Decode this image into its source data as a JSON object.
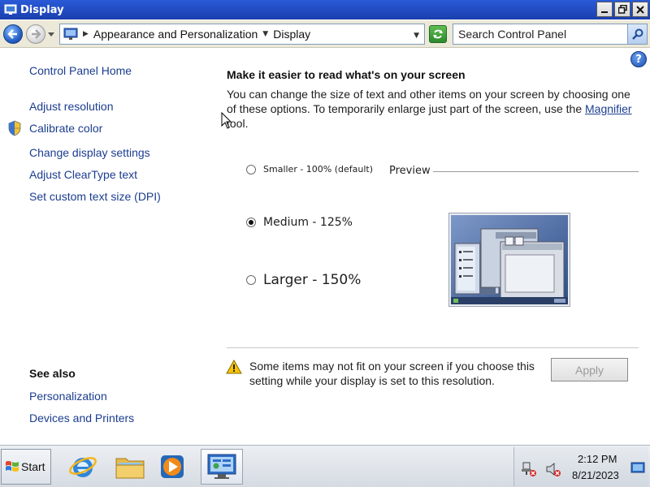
{
  "window": {
    "title": "Display"
  },
  "navbar": {
    "breadcrumb": [
      "Appearance and Personalization",
      "Display"
    ],
    "search_placeholder": "Search Control Panel"
  },
  "left_pane": {
    "links": [
      "Control Panel Home",
      "Adjust resolution",
      "Calibrate color",
      "Change display settings",
      "Adjust ClearType text",
      "Set custom text size (DPI)"
    ],
    "see_also_heading": "See also",
    "see_also_links": [
      "Personalization",
      "Devices and Printers"
    ]
  },
  "main": {
    "heading": "Make it easier to read what's on your screen",
    "description_before_link": "You can change the size of text and other items on your screen by choosing one of these options. To temporarily enlarge just part of the screen, use the ",
    "description_link": "Magnifier",
    "description_after_link": " tool.",
    "options": [
      {
        "label": "Smaller - 100% (default)",
        "selected": false
      },
      {
        "label": "Medium - 125%",
        "selected": true
      },
      {
        "label": "Larger - 150%",
        "selected": false
      }
    ],
    "preview_label": "Preview",
    "warning_text": "Some items may not fit on your screen if you choose this setting while your display is set to this resolution.",
    "apply_label": "Apply"
  },
  "taskbar": {
    "start_label": "Start",
    "time": "2:12 PM",
    "date": "8/21/2023"
  },
  "colors": {
    "title_bar": "#1a3fae",
    "link": "#1b3d8f"
  }
}
